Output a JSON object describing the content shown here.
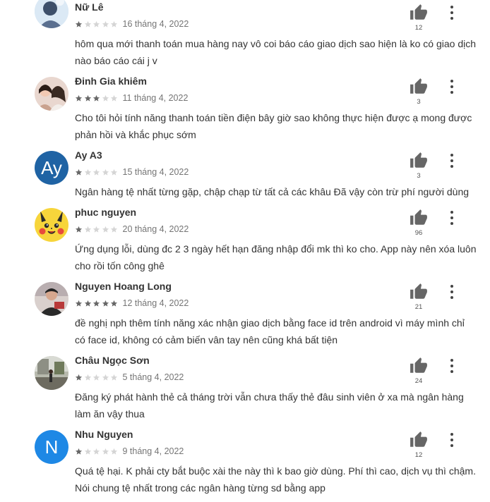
{
  "colors": {
    "star_filled": "#676767",
    "star_empty": "#d5d5d5",
    "avatar_ay": "#1f63a4",
    "avatar_n": "#1e88e5"
  },
  "reviews": [
    {
      "name": "Nữ Lê",
      "rating": 1,
      "date": "16 tháng 4, 2022",
      "text": "hôm qua mới thanh toán mua hàng nay vô coi báo cáo giao dịch sao hiện là ko có giao dịch nào báo cáo cái j v",
      "likes": "12",
      "avatar": "photo-person-icon"
    },
    {
      "name": "Đinh Gia khiêm",
      "rating": 3,
      "date": "11 tháng 4, 2022",
      "text": "Cho tôi hỏi tính năng thanh toán tiền điện bây giờ sao không thực hiện được ạ mong được phản hồi và khắc phục sớm",
      "likes": "3",
      "avatar": "photo-couple-icon"
    },
    {
      "name": "Ay A3",
      "rating": 1,
      "date": "15 tháng 4, 2022",
      "text": "Ngân hàng tệ nhất từng gặp, chập chạp từ tất cả các khâu Đã vậy còn trừ phí người dùng",
      "likes": "3",
      "avatar_letters": "Ay"
    },
    {
      "name": "phuc nguyen",
      "rating": 1,
      "date": "20 tháng 4, 2022",
      "text": "Ứng dụng lỗi, dùng đc 2 3 ngày hết hạn đăng nhập đổi mk thì ko cho. App này nên xóa luôn cho rồi tốn công ghê",
      "likes": "96",
      "avatar": "pikachu-icon"
    },
    {
      "name": "Nguyen Hoang Long",
      "rating": 5,
      "date": "12 tháng 4, 2022",
      "text": "đề nghị nph thêm tính năng xác nhận giao dịch bằng face id trên android vì máy mình chỉ có face id, không có cảm biến vân tay nên cũng khá bất tiện",
      "likes": "21",
      "avatar": "photo-man-icon"
    },
    {
      "name": "Châu Ngọc Sơn",
      "rating": 1,
      "date": "5 tháng 4, 2022",
      "text": "Đăng ký phát hành thẻ cả tháng trời vẫn chưa thấy thẻ đâu sinh viên ở xa mà ngân hàng làm ăn vậy thua",
      "likes": "24",
      "avatar": "photo-outdoor-icon"
    },
    {
      "name": "Nhu Nguyen",
      "rating": 1,
      "date": "9 tháng 4, 2022",
      "text": "Quá tệ hại. K phải cty bắt buộc xài the này thì k bao giờ dùng. Phí thì cao, dịch vụ thì chậm. Nói chung tệ nhất trong các ngân hàng từng sd bằng app",
      "likes": "12",
      "avatar_letters": "N"
    }
  ]
}
